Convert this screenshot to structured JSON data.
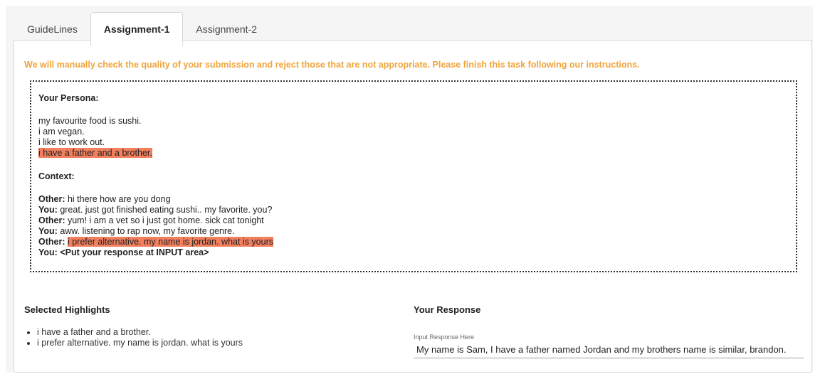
{
  "tabs": [
    "GuideLines",
    "Assignment-1",
    "Assignment-2"
  ],
  "active_tab": "Assignment-1",
  "warning": "We will manually check the quality of your submission and reject those that are not appropriate. Please finish this task following our instructions.",
  "persona": {
    "title": "Your Persona:",
    "lines": [
      "my favourite food is sushi.",
      "i am vegan.",
      "i like to work out.",
      "i have a father and a brother."
    ]
  },
  "context": {
    "title": "Context:",
    "turns": [
      {
        "speaker": "Other:",
        "text": " hi there how are you dong"
      },
      {
        "speaker": "You:",
        "text": " great. just got finished eating sushi.. my favorite. you?"
      },
      {
        "speaker": "Other:",
        "text": " yum! i am a vet so i just got home. sick cat tonight"
      },
      {
        "speaker": "You:",
        "text": " aww. listening to rap now, my favorite genre."
      },
      {
        "speaker": "Other:",
        "text": "i prefer alternative. my name is jordan. what is yours"
      },
      {
        "speaker": "You:",
        "text": " <Put your response at INPUT area>"
      }
    ]
  },
  "highlights": {
    "title": "Selected Highlights",
    "items": [
      "i have a father and a brother.",
      "i prefer alternative. my name is jordan. what is yours"
    ]
  },
  "response": {
    "title": "Your Response",
    "label": "Input Response Here",
    "value": "My name is Sam, I have a father named Jordan and my brothers name is similar, brandon."
  },
  "colors": {
    "highlight": "#f27f5e",
    "warning": "#f0a43a"
  }
}
